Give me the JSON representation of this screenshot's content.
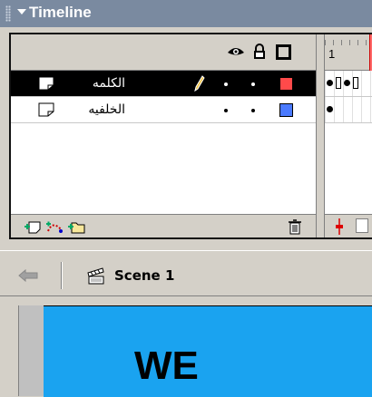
{
  "timeline": {
    "title": "Timeline",
    "frame_label": "1",
    "layers": [
      {
        "name": "الكلمه",
        "color": "#ff4a4a",
        "selected": true
      },
      {
        "name": "الخلفيه",
        "color": "#4a7aff",
        "selected": false
      }
    ]
  },
  "edit_bar": {
    "scene_label": "Scene 1"
  },
  "stage": {
    "text": "WE",
    "background": "#1aa3f0"
  },
  "icons": [
    "eye-icon",
    "lock-icon",
    "outline-icon",
    "layer-icon",
    "pencil-icon",
    "insert-layer-icon",
    "add-motion-guide-icon",
    "insert-folder-icon",
    "trash-icon",
    "center-frame-icon",
    "onion-skin-icon",
    "back-arrow-icon",
    "scene-icon"
  ]
}
